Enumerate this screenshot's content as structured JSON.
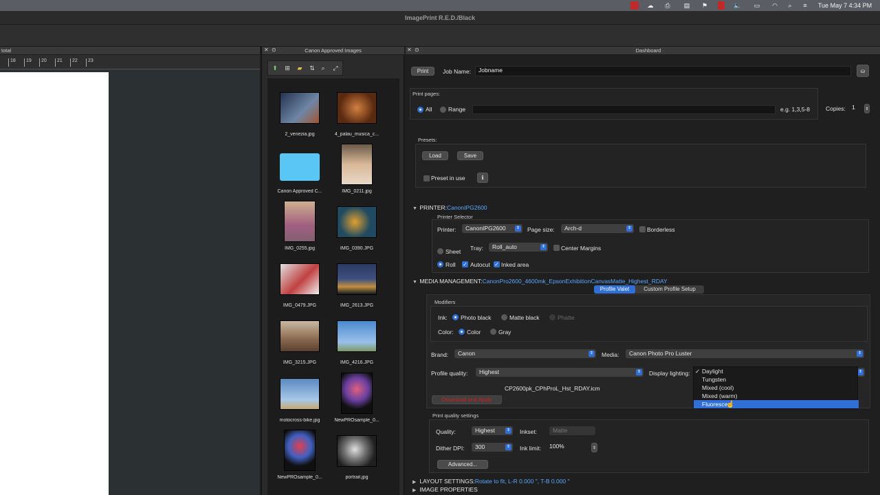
{
  "menubar": {
    "clock": "Tue May 7  4:34 PM"
  },
  "window": {
    "title": "ImagePrint R.E.D./Black"
  },
  "left_panel": {
    "title": "total",
    "ruler": [
      "18",
      "19",
      "20",
      "21",
      "22",
      "23"
    ]
  },
  "images_panel": {
    "title": "Canon Approved Images",
    "thumbs": [
      {
        "caption": "2_venezia.jpg",
        "color": "#6f86a6"
      },
      {
        "caption": "4_palau_musica_c...",
        "color": "#7a4a28"
      },
      {
        "caption": "Canon Approved C...",
        "color": "#54c2f0"
      },
      {
        "caption": "IMG_0211.jpg",
        "color": "#b79a7a"
      },
      {
        "caption": "IMG_0255.jpg",
        "color": "#b07a90"
      },
      {
        "caption": "IMG_0390.JPG",
        "color": "#c48a2a"
      },
      {
        "caption": "IMG_0479.JPG",
        "color": "#c96a6a"
      },
      {
        "caption": "IMG_2613.JPG",
        "color": "#3a4a6a"
      },
      {
        "caption": "IMG_3215.JPG",
        "color": "#8a6a50"
      },
      {
        "caption": "IMG_4216.JPG",
        "color": "#6a9ad0"
      },
      {
        "caption": "motocross-bike.jpg",
        "color": "#7aa0c8"
      },
      {
        "caption": "NewPROsample_0...",
        "color": "#6a3a6a"
      },
      {
        "caption": "NewPROsample_0...",
        "color": "#5a3a7a"
      },
      {
        "caption": "portrait.jpg",
        "color": "#8a8a8a"
      }
    ]
  },
  "dashboard": {
    "title": "Dashboard",
    "print_button": "Print",
    "job_name_label": "Job Name:",
    "job_name_value": "Jobname",
    "print_pages_label": "Print pages:",
    "all_label": "All",
    "range_label": "Range",
    "range_hint": "e.g. 1,3,5-8",
    "copies_label": "Copies:",
    "copies_value": "1",
    "presets_label": "Presets:",
    "load_button": "Load",
    "save_button": "Save",
    "preset_in_use_label": "Preset in use",
    "printer_section": "PRINTER:",
    "printer_section_value": "CanonIPG2600",
    "printer_selector_label": "Printer Selector",
    "printer_label": "Printer:",
    "printer_value": "CanonIPG2600",
    "page_size_label": "Page size:",
    "page_size_value": "Arch-d",
    "borderless_label": "Borderless",
    "sheet_label": "Sheet",
    "tray_label": "Tray:",
    "tray_value": "Roll_auto",
    "center_margins_label": "Center Margins",
    "roll_label": "Roll",
    "autocut_label": "Autocut",
    "inked_area_label": "Inked area",
    "media_section": "MEDIA MANAGEMENT:",
    "media_section_value": "CanonPro2600_4600mk_EpsonExhibitionCanvasMatte_Highest_RDAY",
    "tab_profile_valet": "Profile Valet",
    "tab_custom_profile": "Custom Profile Setup",
    "modifiers_label": "Modifiers",
    "ink_label": "Ink:",
    "photo_black_label": "Photo black",
    "matte_black_label": "Matte black",
    "phatte_label": "Phatte",
    "color_label": "Color:",
    "color_opt": "Color",
    "gray_opt": "Gray",
    "brand_label": "Brand:",
    "brand_value": "Canon",
    "media_label": "Media:",
    "media_value": "Canon Photo Pro Luster",
    "profile_quality_label": "Profile quality:",
    "profile_quality_value": "Highest",
    "display_lighting_label": "Display lighting:",
    "profile_file": "CP2600pk_CPhProL_Hst_RDAY.icm",
    "download_button": "Download and Apply",
    "lighting_options": [
      "Daylight",
      "Tungsten",
      "Mixed (cool)",
      "Mixed (warm)",
      "Fluorescent"
    ],
    "lighting_selected": "Daylight",
    "lighting_highlighted": "Fluorescent",
    "print_quality_settings_label": "Print quality settings",
    "quality_label": "Quality:",
    "quality_value": "Highest",
    "inkset_label": "Inkset:",
    "inkset_value": "Matte",
    "dither_label": "Dither DPI:",
    "dither_value": "300",
    "ink_limit_label": "Ink limit:",
    "ink_limit_value": "100%",
    "advanced_button": "Advanced...",
    "layout_section": "LAYOUT SETTINGS:",
    "layout_section_value": "Rotate to fit, L-R 0.000 \", T-B 0.000 \"",
    "image_props_section": "IMAGE PROPERTIES"
  },
  "colors": {
    "accent": "#2f6fd6",
    "link": "#5aa8ff",
    "download_text": "#d02020"
  }
}
